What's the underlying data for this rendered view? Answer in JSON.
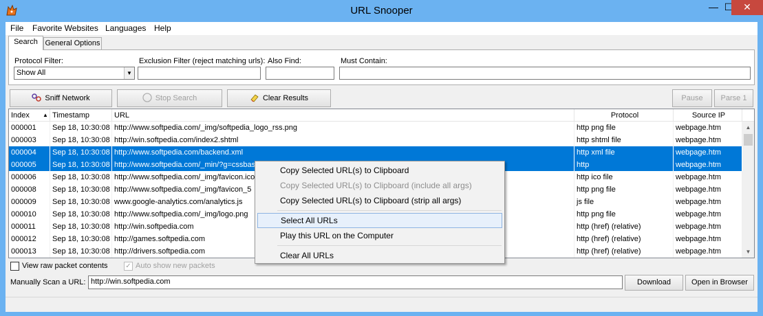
{
  "window": {
    "title": "URL Snooper",
    "minimize": "—",
    "maximize": "☐",
    "close": "✕"
  },
  "menu": [
    "File",
    "Favorite Websites",
    "Languages",
    "Help"
  ],
  "tabs": {
    "search": "Search",
    "general": "General Options"
  },
  "filters": {
    "protocol_label": "Protocol Filter:",
    "protocol_value": "Show All",
    "exclusion_label": "Exclusion Filter (reject matching urls):",
    "exclusion_value": "",
    "also_find_label": "Also Find:",
    "also_find_value": "",
    "must_contain_label": "Must Contain:",
    "must_contain_value": ""
  },
  "toolbar": {
    "sniff": "Sniff Network",
    "stop": "Stop Search",
    "clear": "Clear Results",
    "pause": "Pause",
    "parse": "Parse 1"
  },
  "table": {
    "headers": {
      "index": "Index",
      "timestamp": "Timestamp",
      "url": "URL",
      "protocol": "Protocol",
      "source": "Source IP"
    },
    "rows": [
      {
        "index": "000001",
        "timestamp": "Sep 18, 10:30:08",
        "url": "http://www.softpedia.com/_img/softpedia_logo_rss.png",
        "protocol": "http png file",
        "source": "webpage.htm",
        "selected": false
      },
      {
        "index": "000003",
        "timestamp": "Sep 18, 10:30:08",
        "url": "http://win.softpedia.com/index2.shtml",
        "protocol": "http shtml file",
        "source": "webpage.htm",
        "selected": false
      },
      {
        "index": "000004",
        "timestamp": "Sep 18, 10:30:08",
        "url": "http://www.softpedia.com/backend.xml",
        "protocol": "http xml file",
        "source": "webpage.htm",
        "selected": true
      },
      {
        "index": "000005",
        "timestamp": "Sep 18, 10:30:08",
        "url": "http://www.softpedia.com/_min/?g=cssbas",
        "protocol": "http",
        "source": "webpage.htm",
        "selected": true
      },
      {
        "index": "000006",
        "timestamp": "Sep 18, 10:30:08",
        "url": "http://www.softpedia.com/_img/favicon.ico",
        "protocol": "http ico file",
        "source": "webpage.htm",
        "selected": false
      },
      {
        "index": "000008",
        "timestamp": "Sep 18, 10:30:08",
        "url": "http://www.softpedia.com/_img/favicon_5",
        "protocol": "http png file",
        "source": "webpage.htm",
        "selected": false
      },
      {
        "index": "000009",
        "timestamp": "Sep 18, 10:30:08",
        "url": "www.google-analytics.com/analytics.js",
        "protocol": "js file",
        "source": "webpage.htm",
        "selected": false
      },
      {
        "index": "000010",
        "timestamp": "Sep 18, 10:30:08",
        "url": "http://www.softpedia.com/_img/logo.png",
        "protocol": "http png file",
        "source": "webpage.htm",
        "selected": false
      },
      {
        "index": "000011",
        "timestamp": "Sep 18, 10:30:08",
        "url": "http://win.softpedia.com",
        "protocol": "http (href) (relative)",
        "source": "webpage.htm",
        "selected": false
      },
      {
        "index": "000012",
        "timestamp": "Sep 18, 10:30:08",
        "url": "http://games.softpedia.com",
        "protocol": "http (href) (relative)",
        "source": "webpage.htm",
        "selected": false
      },
      {
        "index": "000013",
        "timestamp": "Sep 18, 10:30:08",
        "url": "http://drivers.softpedia.com",
        "protocol": "http (href) (relative)",
        "source": "webpage.htm",
        "selected": false
      }
    ]
  },
  "context_menu": [
    {
      "label": "Copy Selected URL(s) to Clipboard",
      "disabled": false
    },
    {
      "label": "Copy Selected URL(s) to Clipboard (include all args)",
      "disabled": true
    },
    {
      "label": "Copy Selected URL(s) to Clipboard (strip all args)",
      "disabled": false
    },
    {
      "label": "Select All URLs",
      "disabled": false
    },
    {
      "label": "Play this URL on the Computer",
      "disabled": false
    },
    {
      "label": "Clear All URLs",
      "disabled": false
    }
  ],
  "options": {
    "raw_packet": "View raw packet contents",
    "auto_show": "Auto show new packets",
    "auto_show_checked": true
  },
  "manual": {
    "label": "Manually Scan a URL:",
    "value": "http://win.softpedia.com",
    "download": "Download",
    "open": "Open in Browser"
  },
  "colors": {
    "selection": "#0078d7",
    "titlebar": "#6bb2f1",
    "close": "#c7483e"
  }
}
